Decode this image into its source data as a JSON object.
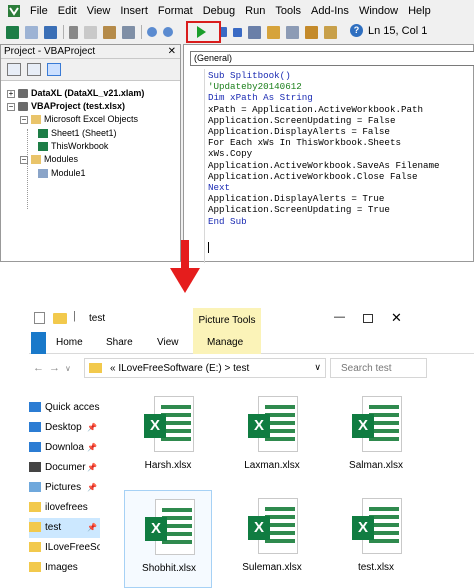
{
  "vba": {
    "menus": [
      "File",
      "Edit",
      "View",
      "Insert",
      "Format",
      "Debug",
      "Run",
      "Tools",
      "Add-Ins",
      "Window",
      "Help"
    ],
    "status": "Ln 15, Col 1",
    "project_title": "Project - VBAProject",
    "tree": {
      "n1": "DataXL (DataXL_v21.xlam)",
      "n2": "VBAProject (test.xlsx)",
      "n3": "Microsoft Excel Objects",
      "n4": "Sheet1 (Sheet1)",
      "n5": "ThisWorkbook",
      "n6": "Modules",
      "n7": "Module1"
    },
    "combo": "(General)",
    "code": {
      "l1": "Sub Splitbook()",
      "l2": "'Updateby20140612",
      "l3": "Dim xPath As String",
      "l4": "xPath = Application.ActiveWorkbook.Path",
      "l5": "Application.ScreenUpdating = False",
      "l6": "Application.DisplayAlerts = False",
      "l7": "For Each xWs In ThisWorkbook.Sheets",
      "l8": "xWs.Copy",
      "l9": "Application.ActiveWorkbook.SaveAs Filename",
      "l10": "Application.ActiveWorkbook.Close False",
      "l11": "Next",
      "l12": "Application.DisplayAlerts = True",
      "l13": "Application.ScreenUpdating = True",
      "l14": "End Sub"
    }
  },
  "explorer": {
    "folder_title": "test",
    "contextual_tab": "Picture Tools",
    "tabs": {
      "home": "Home",
      "share": "Share",
      "view": "View",
      "manage": "Manage"
    },
    "address": [
      "«",
      "ILoveFreeSoftware (E:)",
      ">",
      "test"
    ],
    "search_placeholder": "Search test",
    "nav": [
      "Quick access",
      "Desktop",
      "Downloa",
      "Documer",
      "Pictures",
      "ilovefrees",
      "test",
      "ILoveFreeSo",
      "Images"
    ],
    "files": [
      "Harsh.xlsx",
      "Laxman.xlsx",
      "Salman.xlsx",
      "Shobhit.xlsx",
      "Suleman.xlsx",
      "test.xlsx"
    ]
  },
  "colors": {
    "run_arrow": "#1b9e2b",
    "highlight": "#d91c1c",
    "excel_green": "#107c41",
    "arrow": "#e51d1d"
  }
}
